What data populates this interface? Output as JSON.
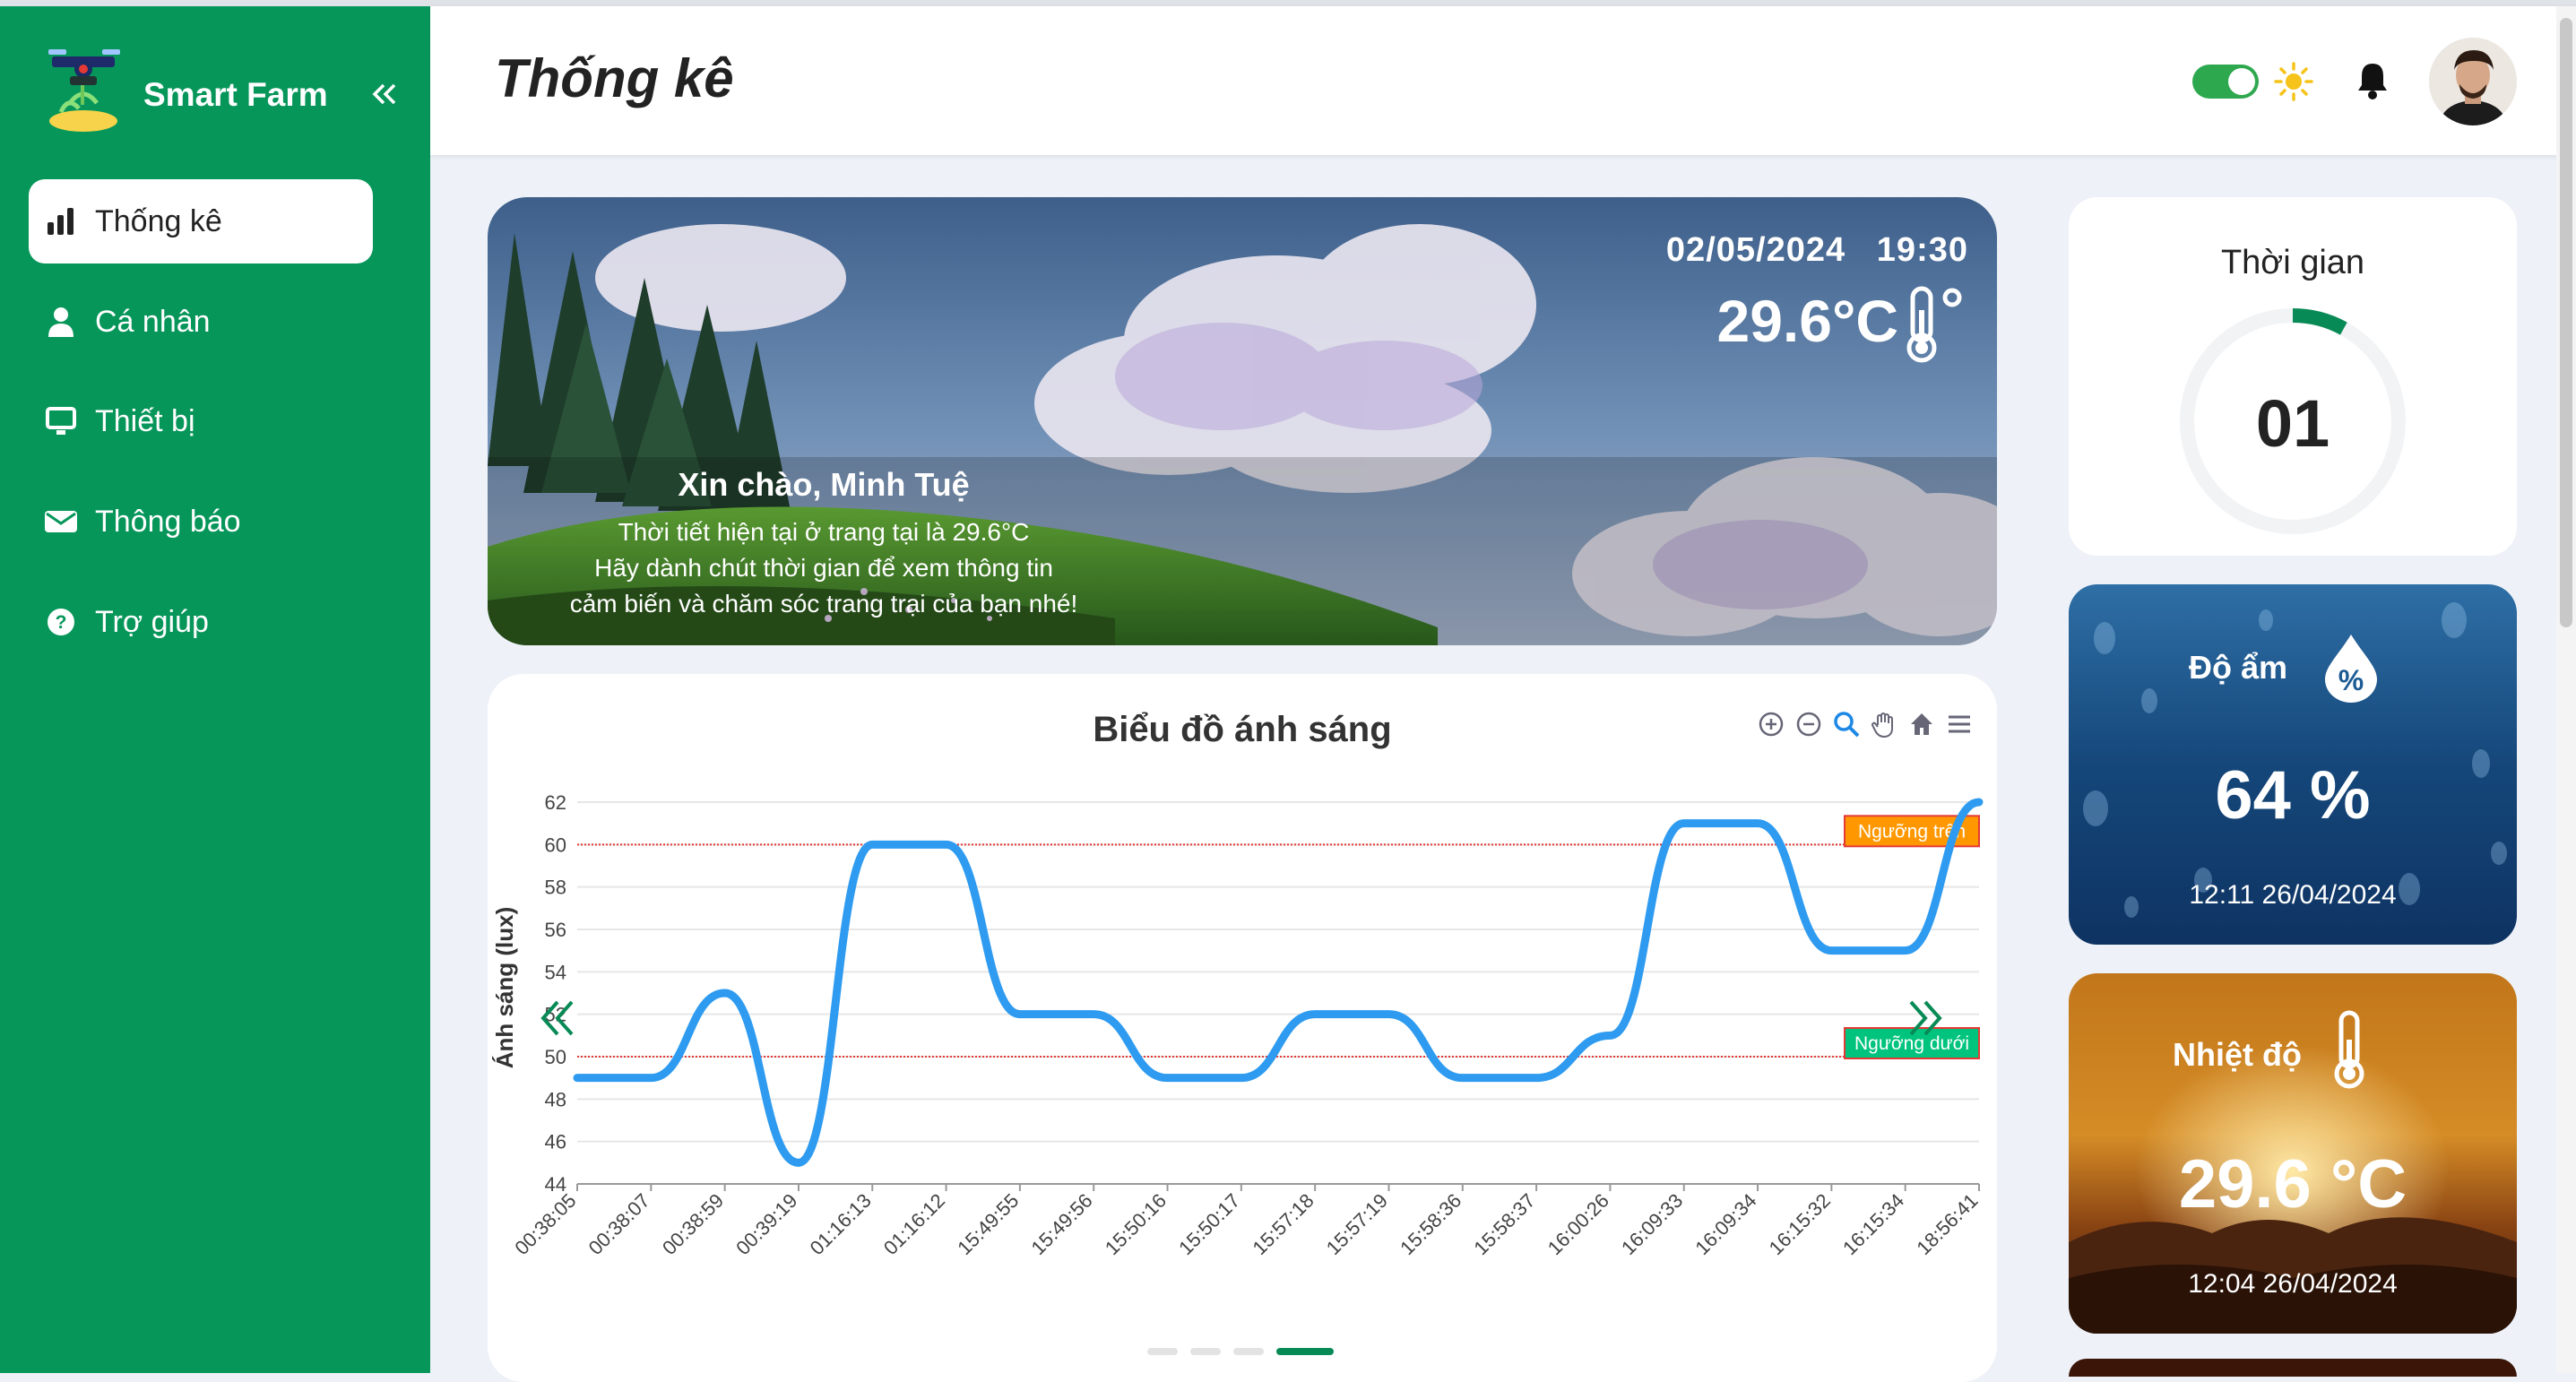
{
  "app": {
    "brand": "Smart Farm"
  },
  "sidebar": {
    "items": [
      {
        "label": "Thống kê",
        "icon": "bar-chart-icon",
        "active": true
      },
      {
        "label": "Cá nhân",
        "icon": "user-icon"
      },
      {
        "label": "Thiết bị",
        "icon": "monitor-icon"
      },
      {
        "label": "Thông báo",
        "icon": "envelope-icon"
      },
      {
        "label": "Trợ giúp",
        "icon": "help-icon"
      }
    ]
  },
  "header": {
    "title": "Thống kê",
    "theme_toggle": "on"
  },
  "hero": {
    "date": "02/05/2024",
    "time": "19:30",
    "temperature": "29.6°C",
    "greeting": "Xin chào, Minh Tuệ",
    "line1": "Thời tiết hiện tại ở trang tại là 29.6°C",
    "line2": "Hãy dành chút thời gian để xem thông tin",
    "line3": "cảm biến và chăm sóc trang trại của bạn nhé!"
  },
  "time_card": {
    "title": "Thời gian",
    "value": "01",
    "progress": 0.08
  },
  "humidity": {
    "label": "Độ ẩm",
    "value": "64 %",
    "timestamp": "12:11 26/04/2024"
  },
  "temperature_card": {
    "label": "Nhiệt độ",
    "value": "29.6 °C",
    "timestamp": "12:04 26/04/2024"
  },
  "chart_data": {
    "type": "line",
    "title": "Biểu đồ ánh sáng",
    "ylabel": "Ánh sáng (lux)",
    "xlabel": "",
    "ylim": [
      44,
      62
    ],
    "yticks": [
      44,
      46,
      48,
      50,
      52,
      54,
      56,
      58,
      60,
      62
    ],
    "categories": [
      "00:38:05",
      "00:38:07",
      "00:38:59",
      "00:39:19",
      "01:16:13",
      "01:16:12",
      "15:49:55",
      "15:49:56",
      "15:50:16",
      "15:50:17",
      "15:57:18",
      "15:57:19",
      "15:58:36",
      "15:58:37",
      "16:00:26",
      "16:09:33",
      "16:09:34",
      "16:15:32",
      "16:15:34",
      "18:56:41"
    ],
    "x_positions": [
      0.5,
      1.5,
      2.5,
      3.5,
      4.5,
      5.5,
      6.5,
      7.5,
      8.5,
      9.5,
      10.5,
      11.5,
      12.5,
      13.5,
      14.5,
      15.5,
      16.5,
      17.5,
      18.5,
      19.5
    ],
    "series": [
      {
        "color": "#2e9bf0",
        "points": [
          [
            0,
            49
          ],
          [
            1,
            49
          ],
          [
            2,
            53
          ],
          [
            3,
            45
          ],
          [
            4,
            60
          ],
          [
            5,
            60
          ],
          [
            6,
            52
          ],
          [
            7,
            52
          ],
          [
            8,
            49
          ],
          [
            9,
            49
          ],
          [
            10,
            52
          ],
          [
            11,
            52
          ],
          [
            12,
            49
          ],
          [
            13,
            49
          ],
          [
            14,
            51
          ],
          [
            15,
            61
          ],
          [
            16,
            61
          ],
          [
            17,
            55
          ],
          [
            18,
            55
          ],
          [
            19,
            62
          ]
        ]
      }
    ],
    "thresholds": [
      {
        "label": "Ngưỡng trên",
        "value": 60,
        "color": "#e53935",
        "label_bg": "#ff9800"
      },
      {
        "label": "Ngưỡng dưới",
        "value": 50,
        "color": "#e53935",
        "label_bg": "#00c47d"
      }
    ],
    "grid": true
  },
  "colors": {
    "sidebar": "#07965a",
    "accent": "#078a56",
    "line": "#2e9bf0"
  }
}
